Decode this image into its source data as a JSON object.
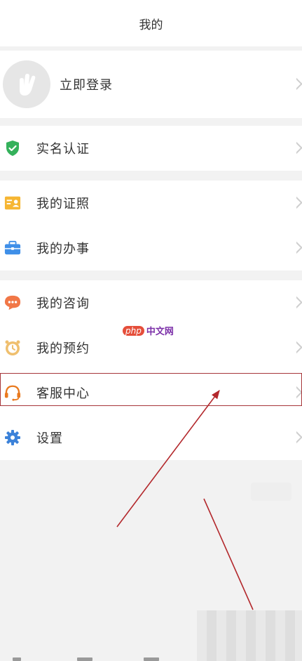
{
  "header": {
    "title": "我的"
  },
  "login": {
    "label": "立即登录"
  },
  "menu": {
    "realname": {
      "label": "实名认证",
      "icon": "shield-check-icon",
      "color": "#34b15b"
    },
    "license": {
      "label": "我的证照",
      "icon": "id-card-icon",
      "color": "#f6b633"
    },
    "affairs": {
      "label": "我的办事",
      "icon": "briefcase-icon",
      "color": "#3f8fe8"
    },
    "consult": {
      "label": "我的咨询",
      "icon": "chat-bubble-icon",
      "color": "#f17747"
    },
    "booking": {
      "label": "我的预约",
      "icon": "alarm-clock-icon",
      "color": "#efbf6e"
    },
    "service": {
      "label": "客服中心",
      "icon": "headset-icon",
      "color": "#e97a1f"
    },
    "settings": {
      "label": "设置",
      "icon": "gear-icon",
      "color": "#3c82d9"
    }
  },
  "watermark": {
    "php": "php",
    "cn": "中文网"
  },
  "colors": {
    "highlight": "#a7363a",
    "arrow": "#b3282c"
  }
}
